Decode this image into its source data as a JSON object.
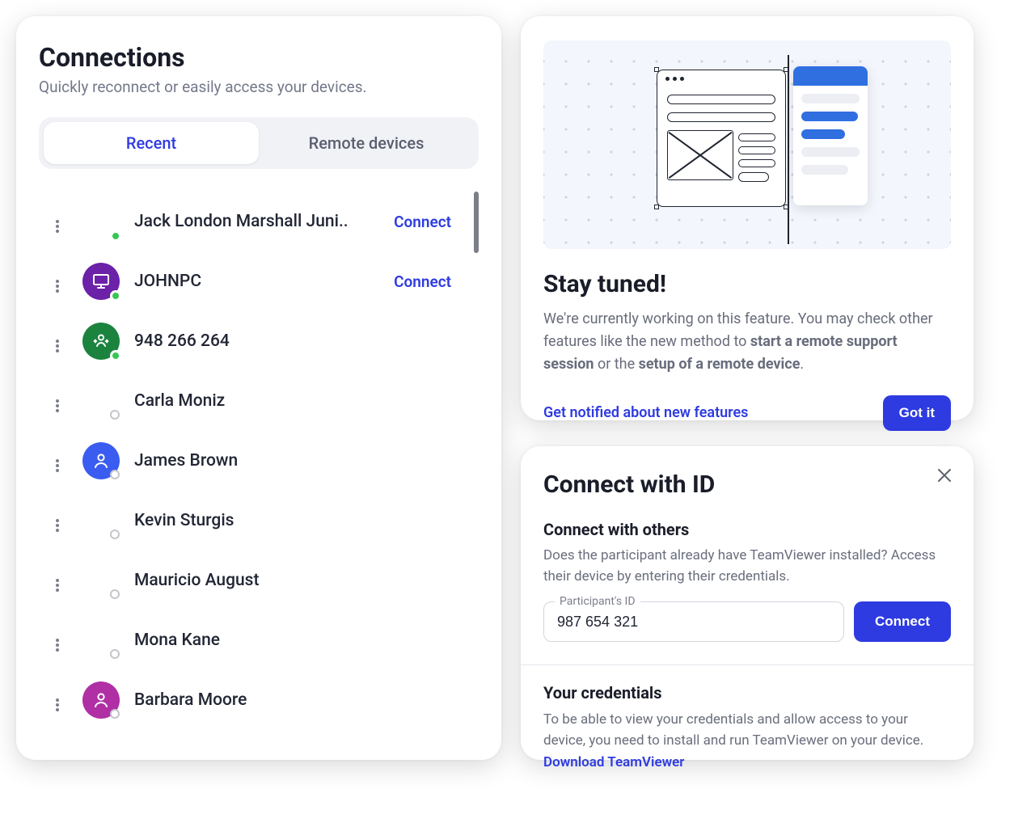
{
  "connections": {
    "title": "Connections",
    "subtitle": "Quickly reconnect or easily access your devices.",
    "tabs": {
      "recent": "Recent",
      "remote": "Remote devices"
    },
    "connect_label": "Connect",
    "items": [
      {
        "name": "Jack London Marshall Juni..",
        "status": "online",
        "avatar": "empty",
        "showConnect": true
      },
      {
        "name": "JOHNPC",
        "status": "online",
        "avatar": "monitor",
        "color": "purple",
        "showConnect": true
      },
      {
        "name": "948 266 264",
        "status": "online",
        "avatar": "transfer",
        "color": "green"
      },
      {
        "name": "Carla Moniz",
        "status": "offline",
        "avatar": "empty"
      },
      {
        "name": "James Brown",
        "status": "offline",
        "avatar": "person",
        "color": "blue"
      },
      {
        "name": "Kevin Sturgis",
        "status": "offline",
        "avatar": "empty"
      },
      {
        "name": "Mauricio August",
        "status": "offline",
        "avatar": "empty"
      },
      {
        "name": "Mona Kane",
        "status": "offline",
        "avatar": "empty"
      },
      {
        "name": "Barbara Moore",
        "status": "offline",
        "avatar": "person",
        "color": "pink"
      }
    ]
  },
  "feature": {
    "title": "Stay tuned!",
    "desc_prefix": "We're currently working on this feature. You may check other features like the new method to ",
    "desc_bold1": "start a remote support session",
    "desc_mid": " or the ",
    "desc_bold2": "setup of a remote device",
    "desc_suffix": ".",
    "notify_link": "Get notified about new features",
    "gotit": "Got it"
  },
  "connectid": {
    "title": "Connect with ID",
    "section1_title": "Connect with others",
    "section1_desc": "Does the participant already have TeamViewer installed? Access their device by entering their credentials.",
    "input_label": "Participant's ID",
    "input_value": "987 654 321",
    "connect_btn": "Connect",
    "section2_title": "Your credentials",
    "section2_desc": "To be able to view your credentials and allow access to your device, you need to install and run TeamViewer on your device.  ",
    "download_link": "Download TeamViewer"
  }
}
